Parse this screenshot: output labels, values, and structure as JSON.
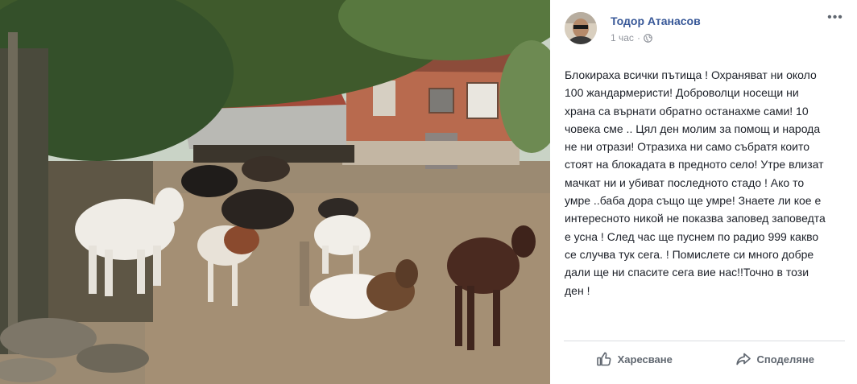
{
  "photo": {
    "description_icon": "photo-goats"
  },
  "post": {
    "author": "Тодор Атанасов",
    "time": "1 час",
    "privacy_icon": "globe-icon",
    "more_label": "•••",
    "text": "Блокираха всички пътища ! Охраняват ни около\n100 жандармеристи! Доброволци носещи ни\nхрана са върнати обратно останахме сами! 10\nчовека сме .. Цял ден молим за помощ и народа\nне ни отрази! Отразиха ни само събратя които\nстоят на блокадата в предното село! Утре влизат\nмачкат ни и убиват последното стадо ! Ако то\nумре ..баба дора също ще умре! Знаете ли кое е\nинтересното никой не показва заповед заповедта\nе усна ! След час ще пуснем по радио 999 какво\nсе случва тук сега. ! Помислете си много добре\nдали ще ни спасите сега вие нас!!Точно в този\nден !"
  },
  "actions": {
    "like_label": "Харесване",
    "share_label": "Споделяне"
  },
  "colors": {
    "author_link": "#385898",
    "meta_gray": "#90949c",
    "action_gray": "#606770"
  }
}
